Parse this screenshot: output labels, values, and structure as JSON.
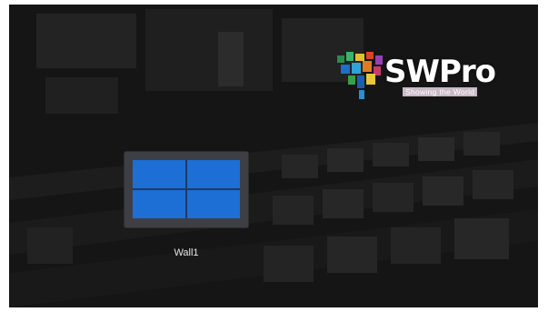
{
  "logo": {
    "brand_text": "SWPro",
    "tagline": "Showing the World"
  },
  "walls": [
    {
      "label": "Wall1",
      "grid_rows": 2,
      "grid_cols": 2,
      "cell_color": "#1d6fd6"
    }
  ],
  "colors": {
    "background": "#141414",
    "card": "#3d3f44",
    "accent": "#1d6fd6"
  }
}
